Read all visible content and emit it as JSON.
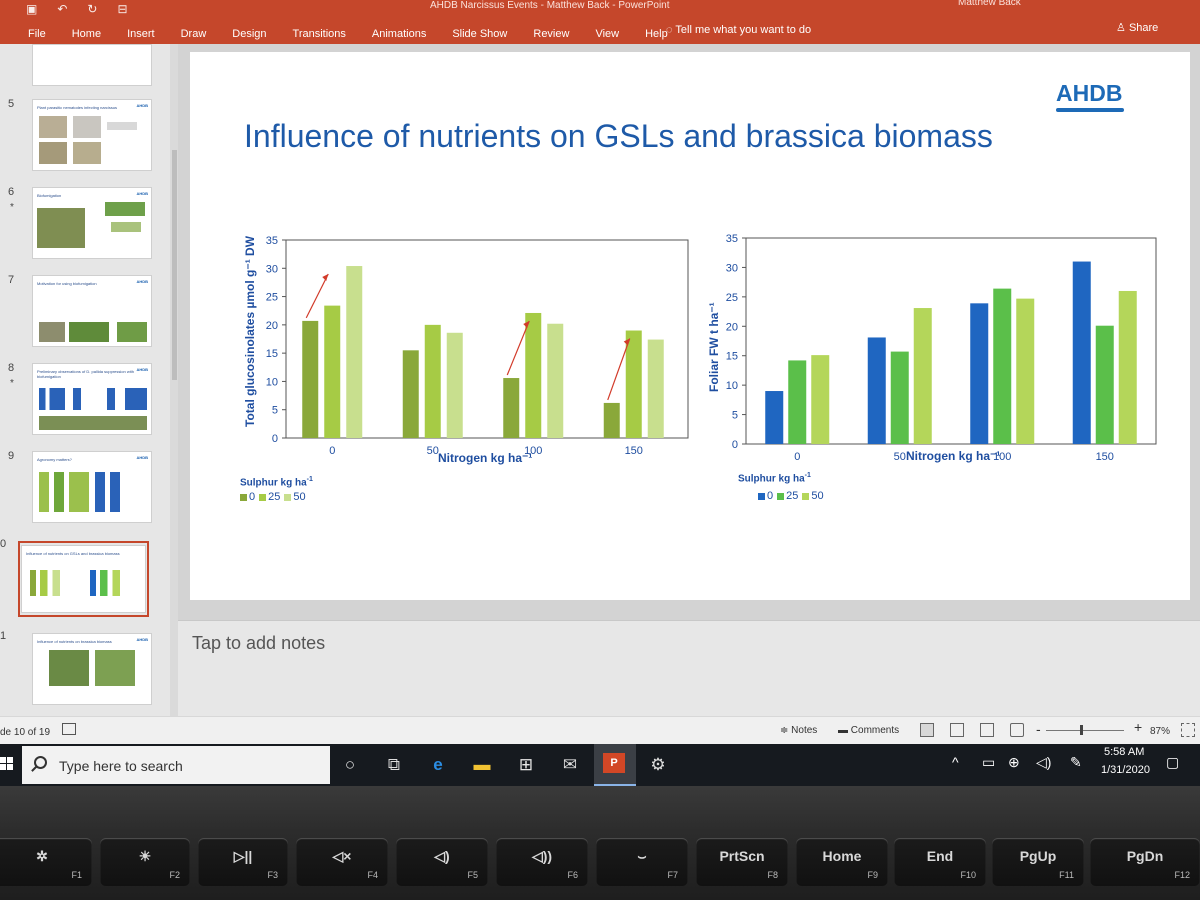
{
  "window": {
    "title": "AHDB Narcissus Events - Matthew Back - PowerPoint",
    "account": "Matthew Back",
    "tabs": [
      "File",
      "Home",
      "Insert",
      "Draw",
      "Design",
      "Transitions",
      "Animations",
      "Slide Show",
      "Review",
      "View",
      "Help"
    ],
    "tell_me": "Tell me what you want to do",
    "share": "Share"
  },
  "thumbnails": {
    "numbers": [
      "5",
      "6",
      "7",
      "8",
      "9",
      "0",
      "1"
    ],
    "stars": [
      "*",
      "*"
    ],
    "slide5_title": "Plant parasitic nematodes infecting narcissus",
    "slide6_title": "Biofumigation",
    "slide7_title": "Motivation for using biofumigation",
    "slide8_title": "Preliminary observations of D. pallida suppression with biofumigation",
    "slide9_title": "Agronomy matters?",
    "slide10_title": "Influence of nutrients on GSLs and brassica biomass",
    "slide11_title": "Influence of nutrients on brassica biomass",
    "logo": "AHDB"
  },
  "slide": {
    "title": "Influence of nutrients on GSLs and brassica biomass",
    "logo": "AHDB",
    "notes_placeholder": "Tap to add notes"
  },
  "colors": {
    "ribbon": "#c5472b",
    "slide_title": "#1e5aa8",
    "left_series": [
      "#8aa83a",
      "#a6cb45",
      "#c8df8e"
    ],
    "right_series": [
      "#1f66c1",
      "#5bbf4a",
      "#b4d65a"
    ]
  },
  "chart_data": [
    {
      "type": "bar",
      "categories": [
        "0",
        "50",
        "100",
        "150"
      ],
      "ylabel": "Total glucosinolates µmol g⁻¹ DW",
      "xlabel": "Nitrogen kg ha⁻¹",
      "ylim": [
        0,
        35
      ],
      "yticks": [
        "0",
        "5",
        "10",
        "15",
        "20",
        "25",
        "30",
        "35"
      ],
      "legend_title": "Sulphur kg ha⁻¹",
      "series": [
        {
          "name": "0",
          "values": [
            20.7,
            15.5,
            10.6,
            6.2
          ]
        },
        {
          "name": "25",
          "values": [
            23.4,
            20.0,
            22.1,
            19.0
          ]
        },
        {
          "name": "50",
          "values": [
            30.4,
            18.6,
            20.2,
            17.4
          ]
        }
      ],
      "annotations": "red arrows from the Sulphur 0 bars pointing up towards the higher bars"
    },
    {
      "type": "bar",
      "categories": [
        "0",
        "50",
        "100",
        "150"
      ],
      "ylabel": "Foliar FW t ha⁻¹",
      "xlabel": "Nitrogen kg ha⁻¹",
      "ylim": [
        0,
        35
      ],
      "yticks": [
        "0",
        "5",
        "10",
        "15",
        "20",
        "25",
        "30",
        "35"
      ],
      "legend_title": "Sulphur kg ha⁻¹",
      "series": [
        {
          "name": "0",
          "values": [
            9.0,
            18.1,
            23.9,
            31.0
          ]
        },
        {
          "name": "25",
          "values": [
            14.2,
            15.7,
            26.4,
            20.1
          ]
        },
        {
          "name": "50",
          "values": [
            15.1,
            23.1,
            24.7,
            26.0
          ]
        }
      ]
    }
  ],
  "legend_labels": {
    "left_title": "Sulphur kg ha",
    "right_title": "Sulphur kg ha",
    "sup": "-1"
  },
  "status_bar": {
    "slide_counter": "de 10 of 19",
    "notes": "Notes",
    "comments": "Comments",
    "zoom_minus": "-",
    "zoom_plus": "+",
    "zoom": "87%",
    "zoom_level": 0.45
  },
  "taskbar": {
    "search_placeholder": "Type here to search",
    "time": "5:58 AM",
    "date": "1/31/2020"
  },
  "keyboard": {
    "keys": [
      {
        "main": "✲",
        "sub": "F1"
      },
      {
        "main": "☀",
        "sub": "F2"
      },
      {
        "main": "▷||",
        "sub": "F3"
      },
      {
        "main": "◁×",
        "sub": "F4"
      },
      {
        "main": "◁)",
        "sub": "F5"
      },
      {
        "main": "◁))",
        "sub": "F6"
      },
      {
        "main": "⌣",
        "sub": "F7"
      },
      {
        "main": "PrtScn",
        "sub": "F8"
      },
      {
        "main": "Home",
        "sub": "F9"
      },
      {
        "main": "End",
        "sub": "F10"
      },
      {
        "main": "PgUp",
        "sub": "F11"
      },
      {
        "main": "PgDn",
        "sub": "F12"
      }
    ]
  }
}
